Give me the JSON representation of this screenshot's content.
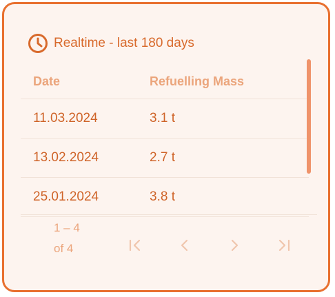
{
  "widget": {
    "title": "Realtime - last 180 days",
    "icon": "clock-icon",
    "accent_color": "#e8702f"
  },
  "table": {
    "columns": [
      "Date",
      "Refuelling Mass"
    ],
    "rows": [
      {
        "date": "11.03.2024",
        "mass": "3.1 t"
      },
      {
        "date": "13.02.2024",
        "mass": "2.7 t"
      },
      {
        "date": "25.01.2024",
        "mass": "3.8 t"
      }
    ]
  },
  "pagination": {
    "range_text": "1 – 4 of 4",
    "buttons": [
      "first-page-icon",
      "previous-page-icon",
      "next-page-icon",
      "last-page-icon"
    ]
  }
}
